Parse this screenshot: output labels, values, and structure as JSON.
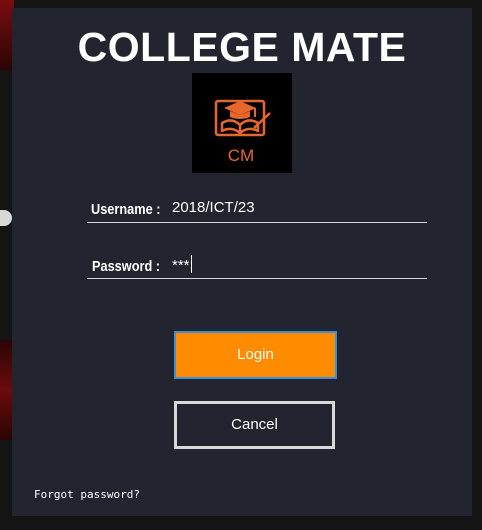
{
  "app": {
    "title": "COLLEGE MATE",
    "logo_text": "CM"
  },
  "form": {
    "username_label": "Username :",
    "username_value": "2018/ICT/23",
    "password_label": "Password :",
    "password_value": "***"
  },
  "buttons": {
    "login_label": "Login",
    "cancel_label": "Cancel"
  },
  "links": {
    "forgot_password": "Forgot password?"
  },
  "colors": {
    "window_bg": "#222530",
    "login_bg": "#ff8c00",
    "logo_orange": "#e8662a"
  },
  "icons": {
    "logo": "graduation-cap-book-icon"
  }
}
